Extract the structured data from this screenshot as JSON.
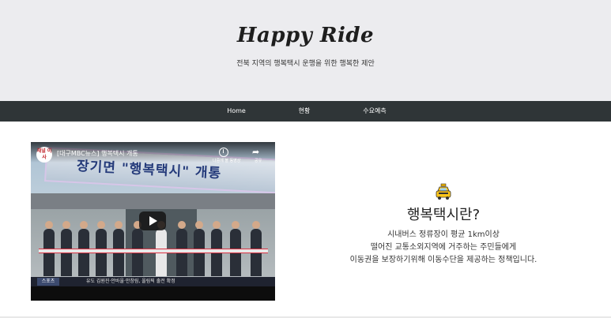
{
  "header": {
    "brand": "Happy Ride",
    "subtitle": "전북 지역의 행복택시 운행을 위한 행복한 제안"
  },
  "nav": {
    "items": [
      {
        "label": "Home"
      },
      {
        "label": "현황"
      },
      {
        "label": "수요예측"
      }
    ]
  },
  "video": {
    "channel_logo": "채널\n이사",
    "title": "[대구MBC뉴스] 행복택시 개통",
    "banner_text": "장기면 \"행복택시\" 개통",
    "watch_later_label": "나중에 볼 동영상",
    "share_label": "공유",
    "caption_tag": "스포츠",
    "caption_text": "유도 김원진·안바울·안창림, 올림픽 출전 확정"
  },
  "info": {
    "icon": "taxi-icon",
    "heading": "행복택시란?",
    "line1": "시내버스 정류장이 평균 1km이상",
    "line2": "떨어진 교통소외지역에 거주하는 주민들에게",
    "line3": "이동권을 보장하기위해 이동수단을 제공하는 정책입니다."
  }
}
